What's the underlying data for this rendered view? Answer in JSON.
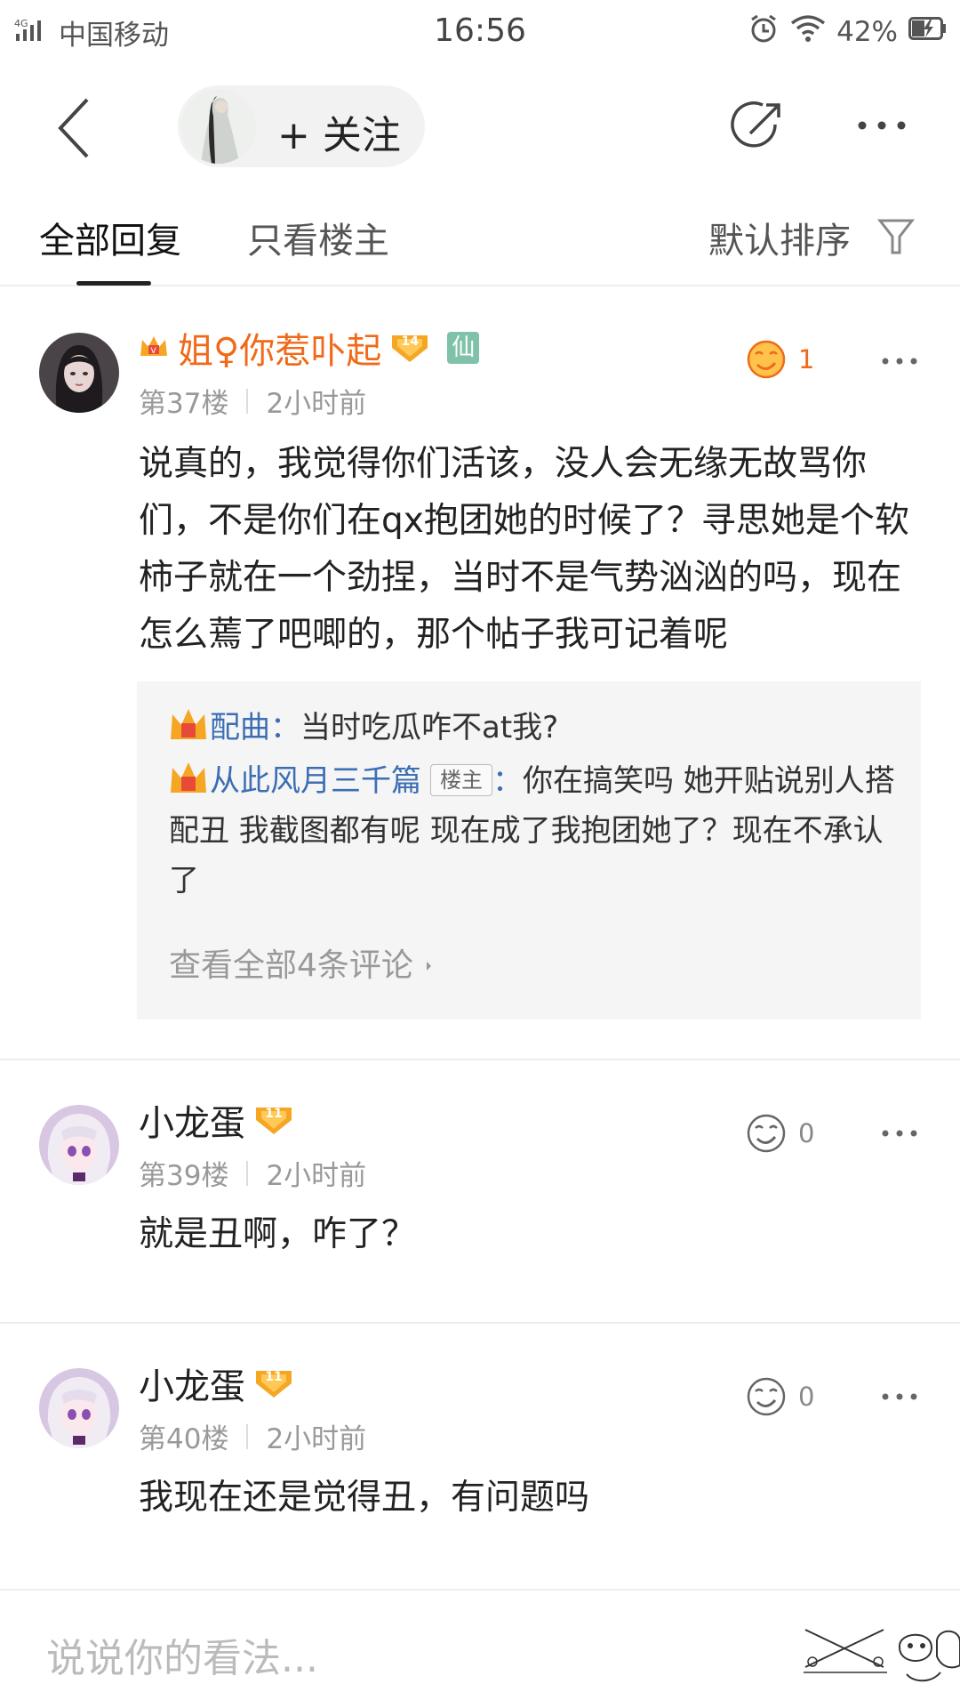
{
  "status_bar": {
    "network": "4G",
    "carrier": "中国移动",
    "time": "16:56",
    "battery": "42%"
  },
  "nav": {
    "follow_label": "+ 关注"
  },
  "tabs": {
    "all_replies": "全部回复",
    "op_only": "只看楼主",
    "sort": "默认排序"
  },
  "posts": [
    {
      "username": "姐♀你惹卟起",
      "level": "14",
      "special_badge": "仙",
      "floor": "第37楼",
      "time": "2小时前",
      "likes": "1",
      "content": "说真的，我觉得你们活该，没人会无缘无故骂你们，不是你们在qx抱团她的时候了？寻思她是个软柿子就在一个劲捏，当时不是气势汹汹的吗，现在怎么蔫了吧唧的，那个帖子我可记着呢",
      "replies": [
        {
          "name": "配曲",
          "sep": "：",
          "text": "当时吃瓜咋不at我?"
        },
        {
          "name": "从此风月三千篇",
          "tag": "楼主",
          "sep": "：",
          "text": "你在搞笑吗 她开贴说别人搭配丑 我截图都有呢 现在成了我抱团她了？现在不承认了"
        }
      ],
      "view_all": "查看全部4条评论"
    },
    {
      "username": "小龙蛋",
      "level": "11",
      "floor": "第39楼",
      "time": "2小时前",
      "likes": "0",
      "content": "就是丑啊，咋了？"
    },
    {
      "username": "小龙蛋",
      "level": "11",
      "floor": "第40楼",
      "time": "2小时前",
      "likes": "0",
      "content": "我现在还是觉得丑，有问题吗"
    }
  ],
  "bottom": {
    "input_placeholder": "说说你的看法..."
  },
  "colors": {
    "vip_name": "#f06a19",
    "reply_name": "#3c6eb4",
    "level_badge": "#f5a623",
    "xian_badge": "#7fc1a9"
  }
}
